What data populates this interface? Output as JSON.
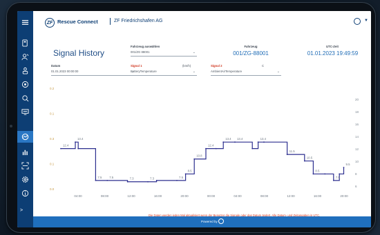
{
  "app": {
    "name": "Rescue Connect",
    "company": "ZF Friedrichshafen AG",
    "logo_letter": "ZF",
    "footer_text": "Powered by"
  },
  "sidebar": {
    "items": [
      {
        "icon": "menu-icon"
      },
      {
        "icon": "device-icon"
      },
      {
        "icon": "search-user-icon"
      },
      {
        "icon": "users-icon"
      },
      {
        "icon": "badge-icon"
      },
      {
        "icon": "location-icon"
      },
      {
        "icon": "monitor-icon"
      },
      {
        "icon": "gauge-icon",
        "active": true
      },
      {
        "icon": "bar-chart-icon"
      },
      {
        "icon": "scan-icon"
      },
      {
        "icon": "settings-icon"
      },
      {
        "icon": "info-icon"
      }
    ],
    "collapse_label": ">"
  },
  "page": {
    "title": "Signal History",
    "vehicle_label": "Fahrzeug auswählen",
    "vehicle_value": "001/ZG 88001",
    "date_label": "Datum",
    "date_value": "01.01.2023 00:00:00",
    "signal1_label": "Signal 1",
    "signal1_unit": "(km/h)",
    "signal1_value": "BatteryTemperature",
    "signal2_label": "Signal 2",
    "signal2_unit": "C",
    "signal2_value": "AmbientAirTemperature",
    "info_vehicle_label": "Fahrzeug",
    "info_vehicle_value": "001/ZG-88001",
    "info_time_label": "UTC-Zeit",
    "info_time_value": "01.01.2023 19:49:59",
    "footnote": "Die Daten werden jeden Mal aktualisiert wenn der Benutzer die Signale oder das Datum ändert. Alle Datum- und Zeitangaben in UTC."
  },
  "colors": {
    "primary": "#0d3e74",
    "accent": "#1f6fbd",
    "line": "#2b2d8e",
    "warning": "#d0341d",
    "left_axis": "#c79a45"
  },
  "chart_data": {
    "type": "line",
    "step": true,
    "x_tick_labels": [
      "04:00",
      "08:00",
      "12:00",
      "16:00",
      "20:00",
      "00:00",
      "04:00",
      "08:00",
      "12:00",
      "16:00",
      "20:00"
    ],
    "left_axis_tick_labels": [
      "0.2",
      "0.1",
      "0.3",
      "0.1",
      "0.0"
    ],
    "right_axis_tick_labels": [
      "20",
      "18",
      "16",
      "14",
      "12",
      "10",
      "8",
      "6"
    ],
    "series": [
      {
        "x": [
          0,
          0.5,
          0.6,
          1.2,
          1.6,
          2.3,
          3.0,
          3.3,
          4.0,
          4.3,
          4.6,
          5.0,
          5.35,
          5.6,
          6.0,
          6.6,
          6.8,
          7.0,
          7.8,
          8.4,
          8.7,
          9.1,
          9.4,
          9.6,
          9.75
        ],
        "y": [
          12.4,
          13.4,
          12.4,
          7.5,
          7.5,
          7.3,
          7.3,
          7.5,
          7.5,
          8.5,
          10.8,
          12.4,
          12.4,
          13.4,
          13.4,
          12.4,
          13.4,
          13.4,
          11.5,
          10.5,
          8.5,
          8.5,
          7.5,
          8.5,
          9.5
        ],
        "y_labels": [
          "12.4",
          "13.4",
          "",
          "7.5",
          "7.5",
          "7.3",
          "7.3",
          "",
          "7.5",
          "8.5",
          "10.8",
          "12.4",
          "",
          "13.4",
          "13.4",
          "",
          "13.4",
          "",
          "11.5",
          "10.5",
          "8.5",
          "",
          "7.5",
          "",
          "9.5"
        ]
      }
    ],
    "right_ylim": [
      6,
      20
    ],
    "grid": false,
    "legend": "none"
  }
}
